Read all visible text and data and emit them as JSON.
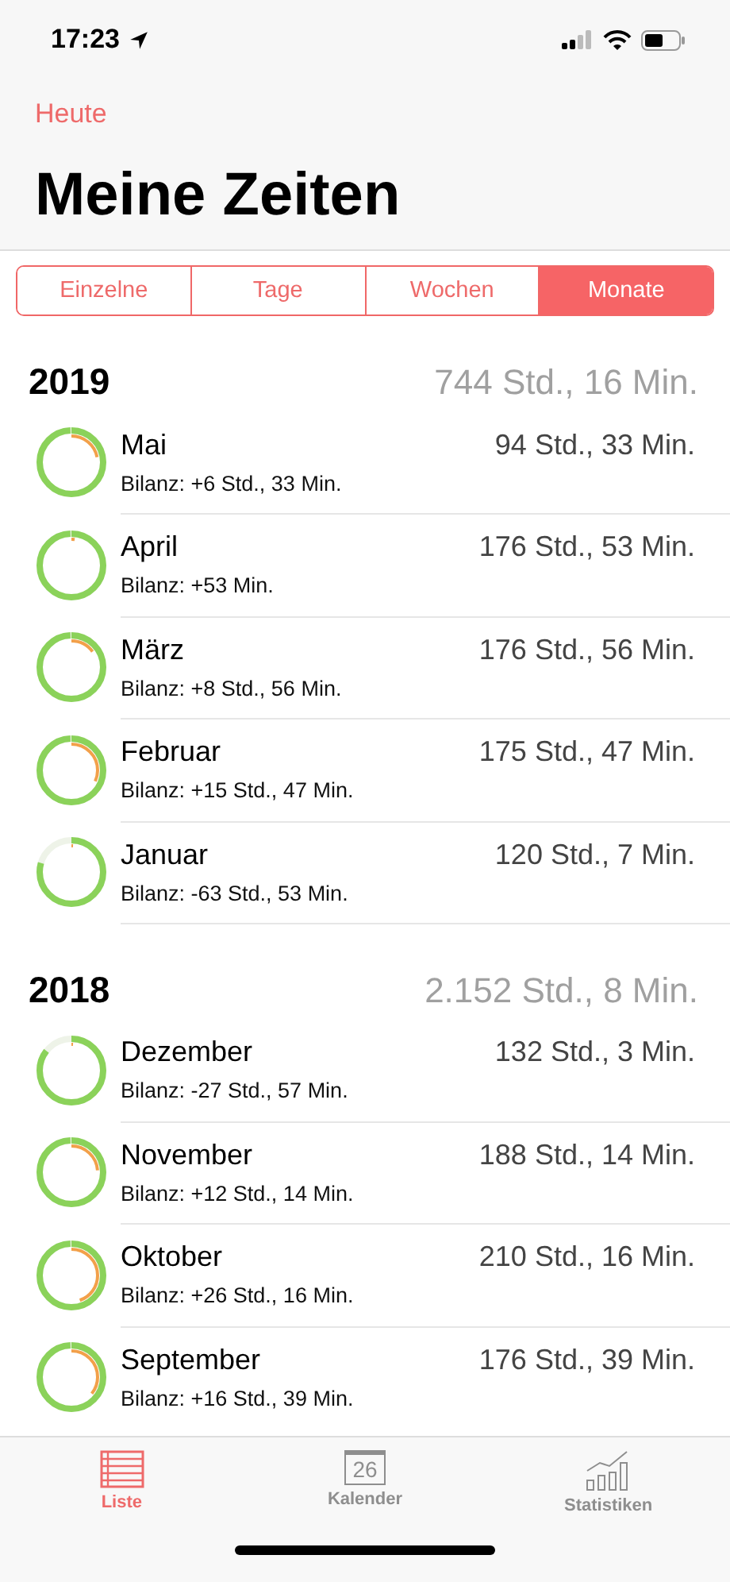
{
  "status_bar": {
    "time": "17:23"
  },
  "nav": {
    "back": "Heute",
    "title": "Meine Zeiten"
  },
  "segments": [
    {
      "label": "Einzelne",
      "selected": false
    },
    {
      "label": "Tage",
      "selected": false
    },
    {
      "label": "Wochen",
      "selected": false
    },
    {
      "label": "Monate",
      "selected": true
    }
  ],
  "sections": [
    {
      "year": "2019",
      "total": "744 Std., 16 Min.",
      "rows": [
        {
          "month": "Mai",
          "total": "94 Std., 33 Min.",
          "balance": "Bilanz: +6 Std., 33 Min.",
          "target": {
            "level": 1
          },
          "overtime": {
            "level": 0.22
          }
        },
        {
          "month": "April",
          "total": "176 Std., 53 Min.",
          "balance": "Bilanz: +53 Min.",
          "target": {
            "level": 1
          },
          "overtime": {
            "level": 0.02
          }
        },
        {
          "month": "März",
          "total": "176 Std., 56 Min.",
          "balance": "Bilanz: +8 Std., 56 Min.",
          "target": {
            "level": 1
          },
          "overtime": {
            "level": 0.15
          }
        },
        {
          "month": "Februar",
          "total": "175 Std., 47 Min.",
          "balance": "Bilanz: +15 Std., 47 Min.",
          "target": {
            "level": 1
          },
          "overtime": {
            "level": 0.32
          }
        },
        {
          "month": "Januar",
          "total": "120 Std., 7 Min.",
          "balance": "Bilanz: -63 Std., 53 Min.",
          "target": {
            "level": 0.8
          },
          "overtime": {
            "level": 0.01
          }
        }
      ]
    },
    {
      "year": "2018",
      "total": "2.152 Std., 8 Min.",
      "rows": [
        {
          "month": "Dezember",
          "total": "132 Std., 3 Min.",
          "balance": "Bilanz: -27 Std., 57 Min.",
          "target": {
            "level": 0.86
          },
          "overtime": {
            "level": 0.01
          }
        },
        {
          "month": "November",
          "total": "188 Std., 14 Min.",
          "balance": "Bilanz: +12 Std., 14 Min.",
          "target": {
            "level": 1
          },
          "overtime": {
            "level": 0.24
          }
        },
        {
          "month": "Oktober",
          "total": "210 Std., 16 Min.",
          "balance": "Bilanz: +26 Std., 16 Min.",
          "target": {
            "level": 1
          },
          "overtime": {
            "level": 0.45
          }
        },
        {
          "month": "September",
          "total": "176 Std., 39 Min.",
          "balance": "Bilanz: +16 Std., 39 Min.",
          "target": {
            "level": 1
          },
          "overtime": {
            "level": 0.36
          }
        }
      ]
    }
  ],
  "tab_bar": [
    {
      "label": "Liste",
      "kind": "list",
      "selected": true
    },
    {
      "label": "Kalender",
      "kind": "calendar",
      "icon_text": "26",
      "selected": false
    },
    {
      "label": "Statistiken",
      "kind": "chart",
      "selected": false
    }
  ]
}
